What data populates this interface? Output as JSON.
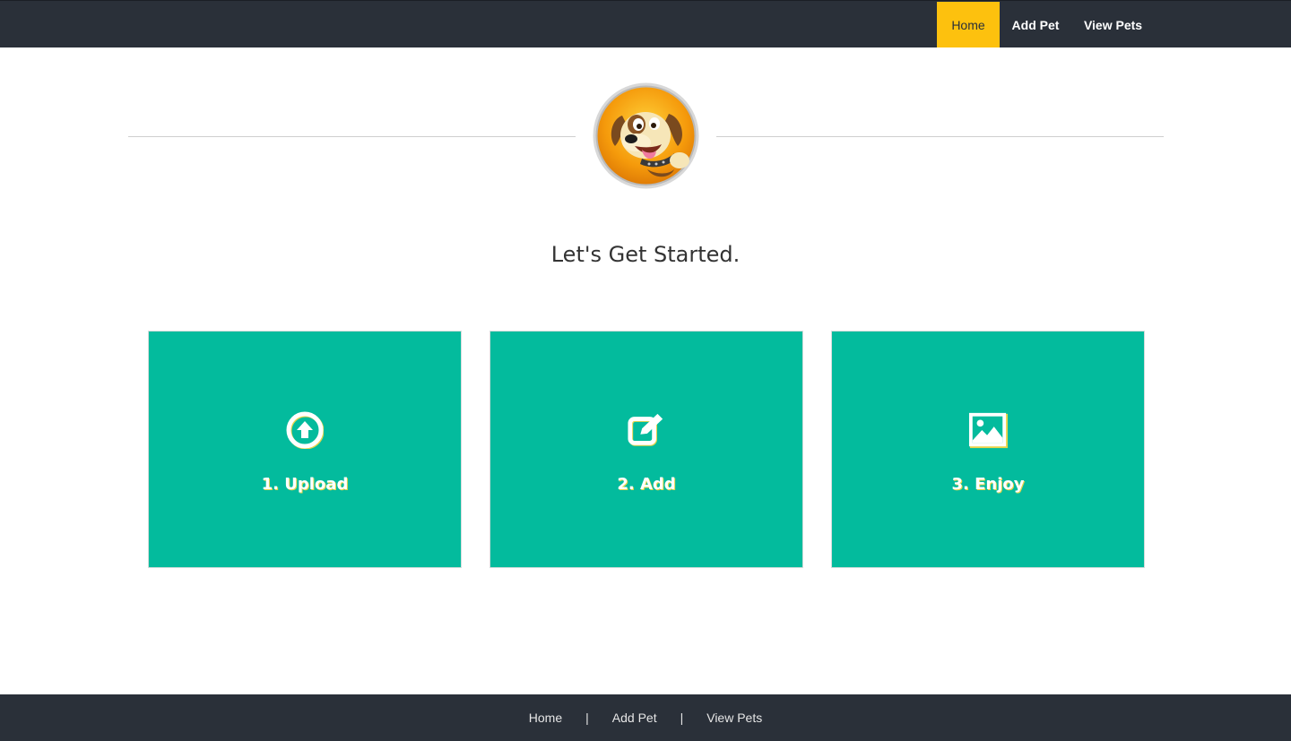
{
  "nav": {
    "items": [
      {
        "label": "Home",
        "active": true
      },
      {
        "label": "Add Pet",
        "active": false
      },
      {
        "label": "View Pets",
        "active": false
      }
    ]
  },
  "hero": {
    "logo": "dog-mascot-logo",
    "headline": "Let's Get Started."
  },
  "cards": [
    {
      "label": "1. Upload",
      "icon": "upload-circle-icon"
    },
    {
      "label": "2. Add",
      "icon": "edit-square-icon"
    },
    {
      "label": "3. Enjoy",
      "icon": "image-icon"
    }
  ],
  "footer": {
    "links": [
      "Home",
      "Add Pet",
      "View Pets"
    ],
    "separator": "|"
  },
  "colors": {
    "nav_bg": "#2a3039",
    "accent": "#fdc10e",
    "card_bg": "#03bb9d"
  }
}
